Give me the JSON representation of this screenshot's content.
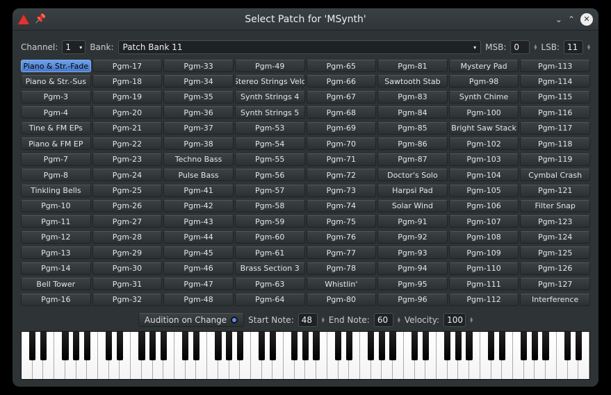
{
  "window": {
    "title": "Select Patch for 'MSynth'"
  },
  "toolbar": {
    "channel_label": "Channel:",
    "channel_value": "1",
    "bank_label": "Bank:",
    "bank_value": "Patch Bank 11",
    "msb_label": "MSB:",
    "msb_value": "0",
    "lsb_label": "LSB:",
    "lsb_value": "11"
  },
  "audition": {
    "toggle_label": "Audition on Change",
    "start_label": "Start Note:",
    "start_value": "48",
    "end_label": "End Note:",
    "end_value": "60",
    "velocity_label": "Velocity:",
    "velocity_value": "100"
  },
  "selected_index": 0,
  "patches": [
    "Piano & Str.-Fade",
    "Piano & Str.-Sus",
    "Pgm-3",
    "Pgm-4",
    "Tine & FM EPs",
    "Piano & FM EP",
    "Pgm-7",
    "Pgm-8",
    "Tinkling Bells",
    "Pgm-10",
    "Pgm-11",
    "Pgm-12",
    "Pgm-13",
    "Pgm-14",
    "Bell Tower",
    "Pgm-16",
    "Pgm-17",
    "Pgm-18",
    "Pgm-19",
    "Pgm-20",
    "Pgm-21",
    "Pgm-22",
    "Pgm-23",
    "Pgm-24",
    "Pgm-25",
    "Pgm-26",
    "Pgm-27",
    "Pgm-28",
    "Pgm-29",
    "Pgm-30",
    "Pgm-31",
    "Pgm-32",
    "Pgm-33",
    "Pgm-34",
    "Pgm-35",
    "Pgm-36",
    "Pgm-37",
    "Pgm-38",
    "Techno Bass",
    "Pulse Bass",
    "Pgm-41",
    "Pgm-42",
    "Pgm-43",
    "Pgm-44",
    "Pgm-45",
    "Pgm-46",
    "Pgm-47",
    "Pgm-48",
    "Pgm-49",
    "Stereo Strings Velo",
    "Synth Strings 4",
    "Synth Strings 5",
    "Pgm-53",
    "Pgm-54",
    "Pgm-55",
    "Pgm-56",
    "Pgm-57",
    "Pgm-58",
    "Pgm-59",
    "Pgm-60",
    "Pgm-61",
    "Brass Section 3",
    "Pgm-63",
    "Pgm-64",
    "Pgm-65",
    "Pgm-66",
    "Pgm-67",
    "Pgm-68",
    "Pgm-69",
    "Pgm-70",
    "Pgm-71",
    "Pgm-72",
    "Pgm-73",
    "Pgm-74",
    "Pgm-75",
    "Pgm-76",
    "Pgm-77",
    "Pgm-78",
    "Whistlin'",
    "Pgm-80",
    "Pgm-81",
    "Sawtooth Stab",
    "Pgm-83",
    "Pgm-84",
    "Pgm-85",
    "Pgm-86",
    "Pgm-87",
    "Doctor's Solo",
    "Harpsi Pad",
    "Solar Wind",
    "Pgm-91",
    "Pgm-92",
    "Pgm-93",
    "Pgm-94",
    "Pgm-95",
    "Pgm-96",
    "Mystery Pad",
    "Pgm-98",
    "Synth Chime",
    "Pgm-100",
    "Bright Saw Stack",
    "Pgm-102",
    "Pgm-103",
    "Pgm-104",
    "Pgm-105",
    "Pgm-106",
    "Pgm-107",
    "Pgm-108",
    "Pgm-109",
    "Pgm-110",
    "Pgm-111",
    "Pgm-112",
    "Pgm-113",
    "Pgm-114",
    "Pgm-115",
    "Pgm-116",
    "Pgm-117",
    "Pgm-118",
    "Pgm-119",
    "Cymbal Crash",
    "Pgm-121",
    "Filter Snap",
    "Pgm-123",
    "Pgm-124",
    "Pgm-125",
    "Pgm-126",
    "Pgm-127",
    "Interference"
  ],
  "keyboard": {
    "white_keys": 52
  }
}
